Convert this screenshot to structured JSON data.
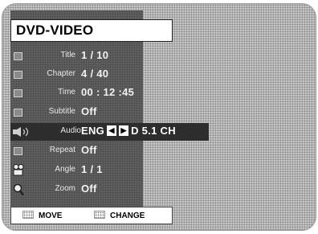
{
  "header": {
    "title": "DVD-VIDEO"
  },
  "menu": {
    "items": [
      {
        "label": "Title",
        "value": "1 / 10",
        "icon": "title-icon"
      },
      {
        "label": "Chapter",
        "value": "4 / 40",
        "icon": "chapter-icon"
      },
      {
        "label": "Time",
        "value": "00 : 12 :45",
        "icon": "time-icon"
      },
      {
        "label": "Subtitle",
        "value": "Off",
        "icon": "subtitle-icon"
      },
      {
        "label": "Audio",
        "value_lang": "ENG",
        "value_fmt": "D 5.1 CH",
        "icon": "speaker-icon",
        "selected": true
      },
      {
        "label": "Repeat",
        "value": "Off",
        "icon": "repeat-icon"
      },
      {
        "label": "Angle",
        "value": "1 / 1",
        "icon": "camera-icon"
      },
      {
        "label": "Zoom",
        "value": "Off",
        "icon": "zoom-icon"
      }
    ]
  },
  "footer": {
    "move_label": "MOVE",
    "change_label": "CHANGE"
  }
}
